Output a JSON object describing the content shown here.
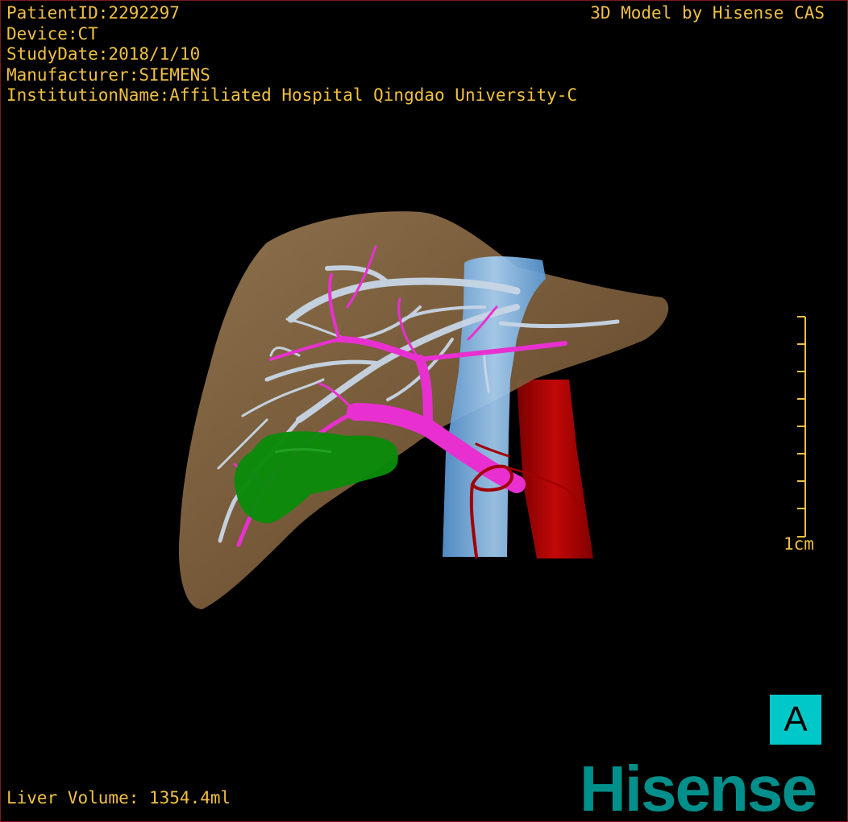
{
  "overlay": {
    "patient_id": "PatientID:2292297",
    "device": "Device:CT",
    "study_date": "StudyDate:2018/1/10",
    "manufacturer": "Manufacturer:SIEMENS",
    "institution": "InstitutionName:Affiliated Hospital Qingdao University-C",
    "model_credit": "3D Model by Hisense CAS",
    "liver_volume": "Liver Volume: 1354.4ml"
  },
  "scale_bar": {
    "label": "1cm",
    "color": "#f0c040"
  },
  "orientation": {
    "letter": "A",
    "color": "#00c8c8"
  },
  "brand": {
    "name": "Hisense",
    "color": "#008f8a"
  },
  "colors": {
    "liver": "#8a6a44",
    "hepatic_vein": "#c8d6e6",
    "portal_vein": "#e830d0",
    "ivc": "#7ab4ec",
    "aorta": "#b00000",
    "tumor": "#0a8a0a",
    "text": "#f0c040"
  }
}
